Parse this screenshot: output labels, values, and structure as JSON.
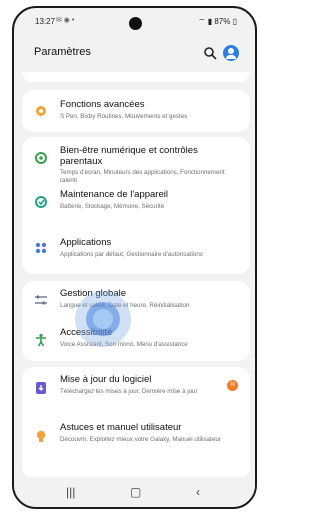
{
  "status": {
    "time": "13:27",
    "battery": "87%"
  },
  "header": {
    "title": "Paramètres"
  },
  "items": [
    {
      "title": "Fonctions avancées",
      "sub": "S Pen, Bixby Routines, Mouvements et gestes"
    },
    {
      "title": "Bien-être numérique et contrôles parentaux",
      "sub": "Temps d'écran, Minuteurs des applications, Fonctionnement ralenti"
    },
    {
      "title": "Maintenance de l'appareil",
      "sub": "Batterie, Stockage, Mémoire, Sécurité"
    },
    {
      "title": "Applications",
      "sub": "Applications par défaut, Gestionnaire d'autorisations"
    },
    {
      "title": "Gestion globale",
      "sub": "Langue et saisie, Date et heure, Réinitialisation"
    },
    {
      "title": "Accessibilité",
      "sub": "Voice Assistant, Son mono, Menu d'assistance"
    },
    {
      "title": "Mise à jour du logiciel",
      "sub": "Téléchargez les mises à jour, Dernière mise à jour",
      "badge": "N"
    },
    {
      "title": "Astuces et manuel utilisateur",
      "sub": "Découvrir, Exploitez mieux votre Galaxy, Manuel utilisateur"
    }
  ],
  "colors": {
    "accent": "#2f7de1",
    "badge": "#f07a2b"
  }
}
